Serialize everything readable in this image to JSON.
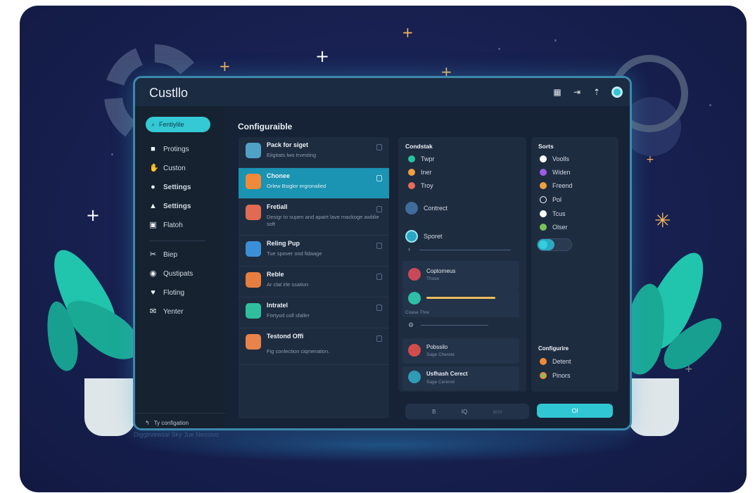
{
  "app": {
    "title": "Custllo"
  },
  "titlebar": {
    "icons": [
      "calendar-icon",
      "export-icon",
      "upload-icon",
      "avatar-icon"
    ]
  },
  "sidebar": {
    "search_label": "Fentiylile",
    "items": [
      {
        "label": "Protings",
        "icon": "briefcase-icon"
      },
      {
        "label": "Custon",
        "icon": "hand-icon"
      },
      {
        "label": "Settings",
        "icon": "lock-icon"
      },
      {
        "label": "Settings",
        "icon": "robot-icon"
      },
      {
        "label": "Flatoh",
        "icon": "image-icon"
      }
    ],
    "items2": [
      {
        "label": "Biep",
        "icon": "tools-icon"
      },
      {
        "label": "Qustipats",
        "icon": "target-icon"
      },
      {
        "label": "Floting",
        "icon": "heart-icon"
      },
      {
        "label": "Yenter",
        "icon": "mail-icon"
      }
    ],
    "footer": "Ty configation"
  },
  "main": {
    "section_title": "Configuraible",
    "list": [
      {
        "title": "Pack for siget",
        "subtitle": "Eiigitats lwo trvesting",
        "color": "#4fa2c6"
      },
      {
        "title": "Chonee",
        "subtitle": "Orlew Bsiglor ergronalied",
        "color": "#f08a3a",
        "selected": true
      },
      {
        "title": "Fretiall",
        "subtitle": "Desigr to supen and apairt lave mackoge awblie soft",
        "color": "#e06b52"
      },
      {
        "title": "Reling Pup",
        "subtitle": "Tue spover ond fidaage",
        "color": "#3b8fd6"
      },
      {
        "title": "Reble",
        "subtitle": "Ar clat irle ssation",
        "color": "#e77d3e"
      },
      {
        "title": "Intratel",
        "subtitle": "Fortyod coll sfaller",
        "color": "#2fbf9e"
      },
      {
        "title": "Testond Offi",
        "subtitle": "Fig conlection ciqmeration.",
        "color": "#e8834a"
      }
    ]
  },
  "middle_panel": {
    "title": "Condstak",
    "rows": [
      {
        "label": "Twpr",
        "color": "#27c1a0"
      },
      {
        "label": "Iner",
        "color": "#f0a040"
      },
      {
        "label": "Troy",
        "color": "#e36d5a"
      }
    ],
    "contrect": "Contrect",
    "sporet": "Sporet",
    "cards": [
      {
        "title": "Coptorneus",
        "subtitle": "Those"
      },
      {
        "title": "",
        "subtitle": "Coase Thre"
      },
      {
        "title": "Pobssilo",
        "subtitle": "Sage Cherete"
      },
      {
        "title": "Usfhash Cerect",
        "subtitle": "Sage Cerenot"
      }
    ],
    "progress": 0.7
  },
  "right_panel": {
    "title": "Sorts",
    "options": [
      {
        "label": "Voolls",
        "color": "#ffffff"
      },
      {
        "label": "Widen",
        "color": "#9b5de5"
      },
      {
        "label": "Freend",
        "color": "#f0a040"
      },
      {
        "label": "Pol",
        "color": "#1e2c40"
      },
      {
        "label": "Tcus",
        "color": "#ffffff"
      },
      {
        "label": "Olser",
        "color": "#7cc25a"
      }
    ],
    "toggle_on": true,
    "config_title": "Configurire",
    "config_options": [
      {
        "label": "Detent",
        "color": "#f08a3a"
      },
      {
        "label": "Pinors",
        "color": "#7cc25a"
      }
    ]
  },
  "bottom": {
    "buttons": [
      "B",
      "IQ",
      "ann"
    ],
    "ok_label": "Ol"
  },
  "floor_text": "Diggirvewsal Sky Jue Neosivo"
}
